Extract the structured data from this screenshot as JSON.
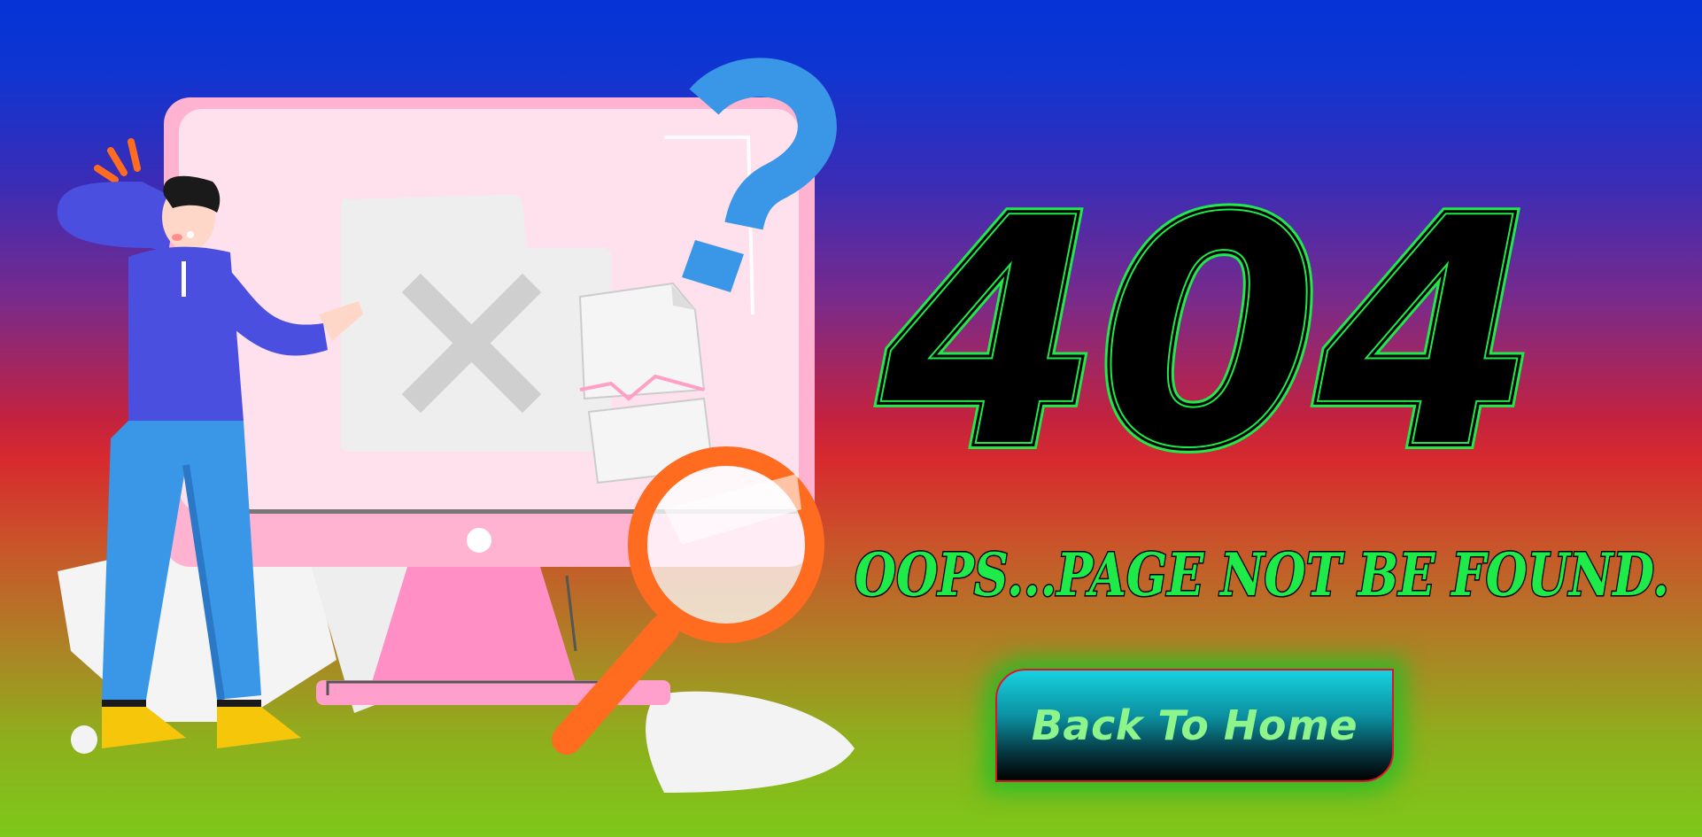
{
  "error": {
    "code": "404",
    "message": "OOPS...PAGE NOT BE FOUND."
  },
  "actions": {
    "home_label": "Back To Home"
  },
  "illustration": {
    "icons": [
      "computer-monitor-icon",
      "question-mark-icon",
      "magnifying-glass-icon",
      "broken-document-icon",
      "error-x-icon",
      "confused-person-icon"
    ]
  },
  "colors": {
    "gradient_top": "#0433d6",
    "gradient_middle": "#d72a2e",
    "gradient_bottom": "#7dc81a",
    "text_outline_green": "#1eea4a",
    "button_text": "#8ef58c",
    "button_border": "#e3102a"
  }
}
